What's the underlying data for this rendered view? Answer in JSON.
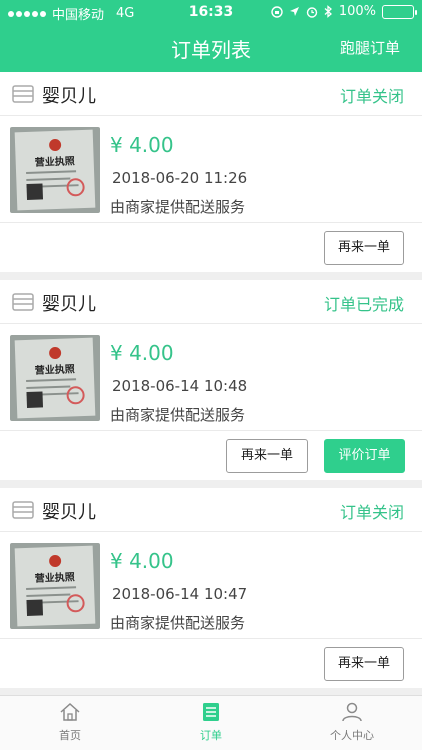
{
  "status_bar": {
    "carrier": "中国移动",
    "network": "4G",
    "time": "16:33",
    "battery": "100%",
    "battery_level": 1.0
  },
  "header": {
    "title": "订单列表",
    "right_action": "跑腿订单",
    "bg_color": "#2fcf8d"
  },
  "orders": [
    {
      "shop": "婴贝儿",
      "status": "订单关闭",
      "price": "¥ 4.00",
      "datetime": "2018-06-20 11:26",
      "delivery": "由商家提供配送服务",
      "reorder_label": "再来一单"
    },
    {
      "shop": "婴贝儿",
      "status": "订单已完成",
      "price": "¥ 4.00",
      "datetime": "2018-06-14 10:48",
      "delivery": "由商家提供配送服务",
      "reorder_label": "再来一单",
      "review_label": "评价订单"
    },
    {
      "shop": "婴贝儿",
      "status": "订单关闭",
      "price": "¥ 4.00",
      "datetime": "2018-06-14 10:47",
      "delivery": "由商家提供配送服务",
      "reorder_label": "再来一单"
    }
  ],
  "thumbnail_title": "营业执照",
  "tabbar": {
    "items": [
      {
        "label": "首页",
        "icon": "home-icon"
      },
      {
        "label": "订单",
        "icon": "order-list-icon",
        "active": true
      },
      {
        "label": "个人中心",
        "icon": "user-icon"
      }
    ],
    "accent": "#2fcf8d"
  }
}
